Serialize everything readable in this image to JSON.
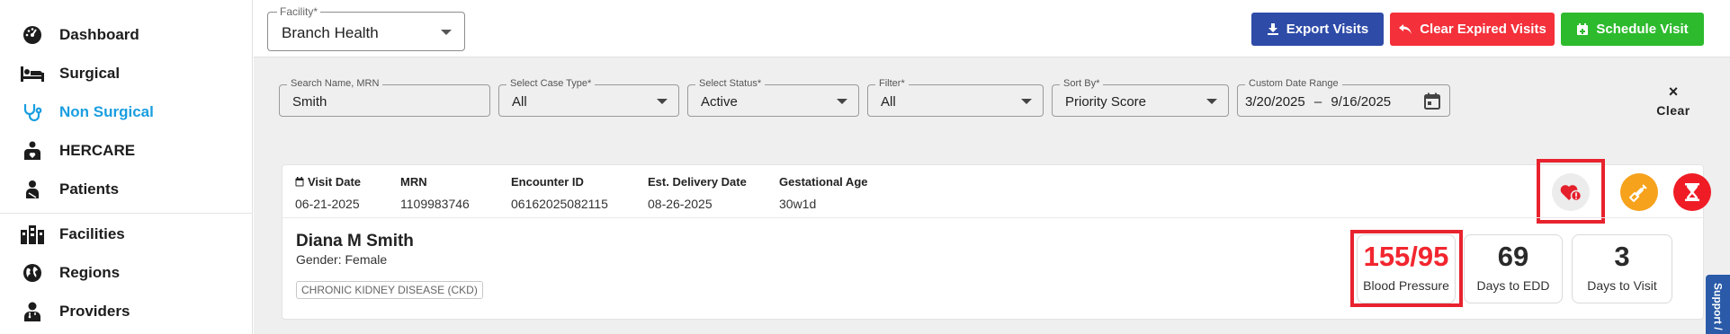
{
  "sidebar": {
    "items": [
      {
        "label": "Dashboard",
        "icon": "dashboard-icon"
      },
      {
        "label": "Surgical",
        "icon": "bed-icon"
      },
      {
        "label": "Non Surgical",
        "icon": "stethoscope-icon",
        "active": true
      },
      {
        "label": "HERCARE",
        "icon": "heart-hands-icon"
      },
      {
        "label": "Patients",
        "icon": "patient-icon"
      },
      {
        "label": "Facilities",
        "icon": "building-icon"
      },
      {
        "label": "Regions",
        "icon": "globe-icon"
      },
      {
        "label": "Providers",
        "icon": "doctor-icon"
      }
    ]
  },
  "toolbar": {
    "facility_label": "Facility*",
    "facility_value": "Branch Health",
    "export_label": "Export Visits",
    "clear_expired_label": "Clear Expired Visits",
    "schedule_label": "Schedule Visit"
  },
  "filters": {
    "search": {
      "label": "Search Name, MRN",
      "value": "Smith"
    },
    "case_type": {
      "label": "Select Case Type*",
      "value": "All"
    },
    "status": {
      "label": "Select Status*",
      "value": "Active"
    },
    "filter": {
      "label": "Filter*",
      "value": "All"
    },
    "sort_by": {
      "label": "Sort By*",
      "value": "Priority Score"
    },
    "date_range": {
      "label": "Custom Date Range",
      "start": "3/20/2025",
      "separator": "–",
      "end": "9/16/2025"
    },
    "clear_label": "Clear"
  },
  "visit_card": {
    "visit_date": {
      "label": "Visit Date",
      "value": "06-21-2025"
    },
    "mrn": {
      "label": "MRN",
      "value": "1109983746"
    },
    "encounter_id": {
      "label": "Encounter ID",
      "value": "06162025082115"
    },
    "delivery_date": {
      "label": "Est. Delivery Date",
      "value": "08-26-2025"
    },
    "gestational_age": {
      "label": "Gestational Age",
      "value": "30w1d"
    },
    "patient_name": "Diana M Smith",
    "gender": "Gender: Female",
    "condition_tag": "CHRONIC KIDNEY DISEASE (CKD)",
    "stats": {
      "blood_pressure": {
        "value": "155/95",
        "label": "Blood Pressure"
      },
      "days_to_edd": {
        "value": "69",
        "label": "Days to EDD"
      },
      "days_to_visit": {
        "value": "3",
        "label": "Days to Visit"
      }
    }
  },
  "support_label": "Support /",
  "colors": {
    "accent_blue": "#1a9ee0",
    "export": "#2e4ba8",
    "clear_expired": "#f4303a",
    "schedule": "#2dbb2d",
    "alert_red": "#f2262f",
    "syringe": "#f6a21c"
  }
}
